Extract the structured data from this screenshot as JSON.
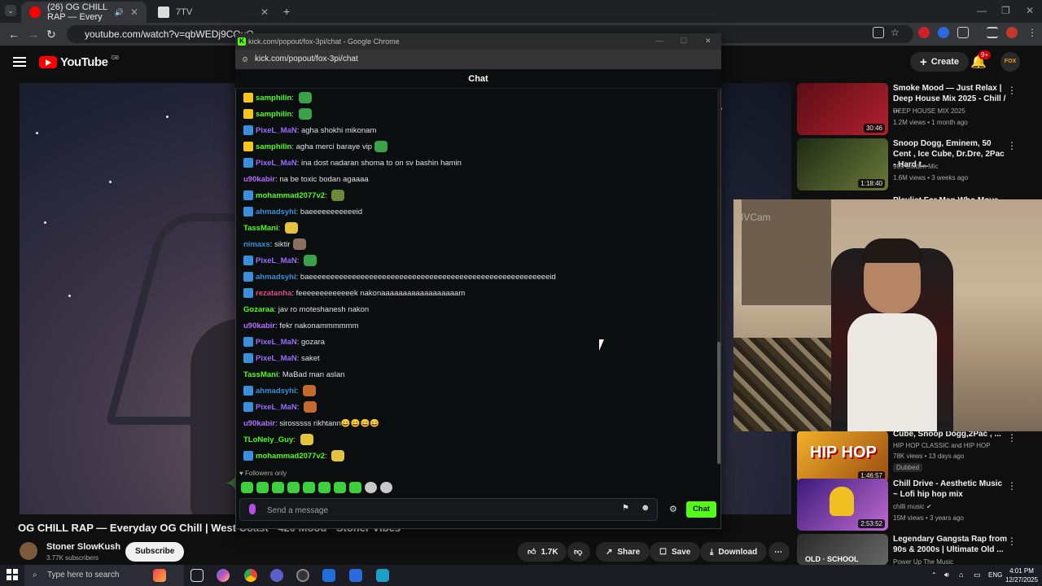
{
  "browser": {
    "tabs": [
      {
        "title": "(26) OG CHILL RAP — Every",
        "active": true,
        "favicon_color": "#ff0000"
      },
      {
        "title": "7TV",
        "active": false,
        "favicon_color": "#dddddd"
      }
    ],
    "url": "youtube.com/watch?v=qbWEDj9CQuQ"
  },
  "youtube": {
    "logo_text": "YouTube",
    "region": "GB",
    "create_label": "Create",
    "notif_badge": "9+",
    "avatar_text": "FOX",
    "video_title": "OG CHILL RAP — Everyday OG Chill | West Coast · 420 Mood · Stoner Vibes",
    "channel": "Stoner SlowKush",
    "subscribers": "3.77K subscribers",
    "subscribe_label": "Subscribe",
    "likes": "1.7K",
    "share_label": "Share",
    "save_label": "Save",
    "download_label": "Download"
  },
  "recommendations": [
    {
      "title": "Smoke Mood — Just Relax | Deep House Mix 2025 - Chill / ...",
      "channel": "DEEP HOUSE MIX 2025",
      "meta": "1.2M views • 1 month ago",
      "duration": "30:46",
      "color": "#8a1f2a"
    },
    {
      "title": "Snoop Dogg, Eminem, 50 Cent , Ice Cube, Dr.Dre, 2Pac - Hard t...",
      "channel": "90s Golden Mic",
      "meta": "1.6M views • 3 weeks ago",
      "duration": "1:18:40",
      "color": "#3b4a2a"
    },
    {
      "title": "Cube, Snoop Dogg,2Pac , ...",
      "channel": "HIP HOP CLASSIC and HIP HOP",
      "meta": "78K views • 13 days ago",
      "duration": "1:46:57",
      "badge": "Dubbed",
      "color": "#c47a1a"
    },
    {
      "title": "Chill Drive - Aesthetic Music ~ Lofi hip hop mix",
      "channel": "chilli music",
      "meta": "15M views • 3 years ago",
      "duration": "2:53:52",
      "color": "#6a3aa8"
    },
    {
      "title": "Legendary Gangsta Rap from 90s & 2000s | Ultimate Old ...",
      "channel": "Power Up The Music",
      "meta": "",
      "duration": "",
      "color": "#444444"
    }
  ],
  "webcam": {
    "label": "IVCam"
  },
  "chat_popup": {
    "window_title": "kick.com/popout/fox-3pi/chat - Google Chrome",
    "url": "kick.com/popout/fox-3pi/chat",
    "header": "Chat",
    "followers_only": "Followers only",
    "input_placeholder": "Send a message",
    "send_label": "Chat",
    "messages": [
      {
        "user": "samphilin",
        "text": "",
        "badge": "crown",
        "color": "#53fc18",
        "emote": "#3aa34a"
      },
      {
        "user": "samphilin",
        "text": "",
        "badge": "crown",
        "color": "#53fc18",
        "emote": "#3aa34a"
      },
      {
        "user": "PixeL_MaN",
        "text": "agha shokhi mikonam",
        "badge": "blue",
        "color": "#9b6cff",
        "emote": ""
      },
      {
        "user": "samphilin",
        "text": "agha merci baraye vip",
        "badge": "crown",
        "color": "#53fc18",
        "emote": "#3aa34a"
      },
      {
        "user": "PixeL_MaN",
        "text": "ina dost nadaran shoma to on sv bashin hamin",
        "badge": "blue",
        "color": "#9b6cff",
        "emote": ""
      },
      {
        "user": "u90kabir",
        "text": "na be toxic bodan agaaaa",
        "badge": "",
        "color": "#b66cff",
        "emote": ""
      },
      {
        "user": "mohammad2077v2",
        "text": "",
        "badge": "blue",
        "color": "#53fc18",
        "emote": "#6b8a3a"
      },
      {
        "user": "ahmadsyhi",
        "text": "baeeeeeeeeeeeid",
        "badge": "blue",
        "color": "#3a8fdc",
        "emote": ""
      },
      {
        "user": "TassMani",
        "text": "",
        "badge": "",
        "color": "#53fc18",
        "emote": "#e3c43a"
      },
      {
        "user": "nimaxs",
        "text": "siktir",
        "badge": "",
        "color": "#3a8fdc",
        "emote": "#8a7060"
      },
      {
        "user": "PixeL_MaN",
        "text": "",
        "badge": "blue",
        "color": "#9b6cff",
        "emote": "#3aa34a"
      },
      {
        "user": "ahmadsyhi",
        "text": "baeeeeeeeeeeeeeeeeeeeeeeeeeeeeeeeeeeeeeeeeeeeeeeeeeeeeeeeeid",
        "badge": "blue",
        "color": "#3a8fdc",
        "emote": ""
      },
      {
        "user": "rezatanha",
        "text": "feeeeeeeeeeeeek nakonaaaaaaaaaaaaaaaaaam",
        "badge": "blue",
        "color": "#e04a8a",
        "emote": ""
      },
      {
        "user": "Gozaraa",
        "text": "jav ro moteshanesh nakon",
        "badge": "",
        "color": "#53fc18",
        "emote": ""
      },
      {
        "user": "u90kabir",
        "text": "fekr nakonammmmmm",
        "badge": "",
        "color": "#b66cff",
        "emote": ""
      },
      {
        "user": "PixeL_MaN",
        "text": "gozara",
        "badge": "blue",
        "color": "#9b6cff",
        "emote": ""
      },
      {
        "user": "PixeL_MaN",
        "text": "saket",
        "badge": "blue",
        "color": "#9b6cff",
        "emote": ""
      },
      {
        "user": "TassMani",
        "text": "MaBad man aslan",
        "badge": "",
        "color": "#53fc18",
        "emote": ""
      },
      {
        "user": "ahmadsyhi",
        "text": "",
        "badge": "blue",
        "color": "#3a8fdc",
        "emote": "#c46a2a"
      },
      {
        "user": "PixeL_MaN",
        "text": "",
        "badge": "blue",
        "color": "#9b6cff",
        "emote": "#c46a2a"
      },
      {
        "user": "u90kabir",
        "text": "sirosssss rikhtann😄😄😄😄",
        "badge": "",
        "color": "#b66cff",
        "emote": ""
      },
      {
        "user": "TLoNely_Guy",
        "text": "",
        "badge": "",
        "color": "#53fc18",
        "emote": "#e3c43a"
      },
      {
        "user": "mohammad2077v2",
        "text": "",
        "badge": "blue",
        "color": "#53fc18",
        "emote": "#e3c43a"
      }
    ]
  },
  "taskbar": {
    "search_placeholder": "Type here to search",
    "lang": "ENG",
    "time": "4:01 PM",
    "date": "12/27/2025"
  }
}
